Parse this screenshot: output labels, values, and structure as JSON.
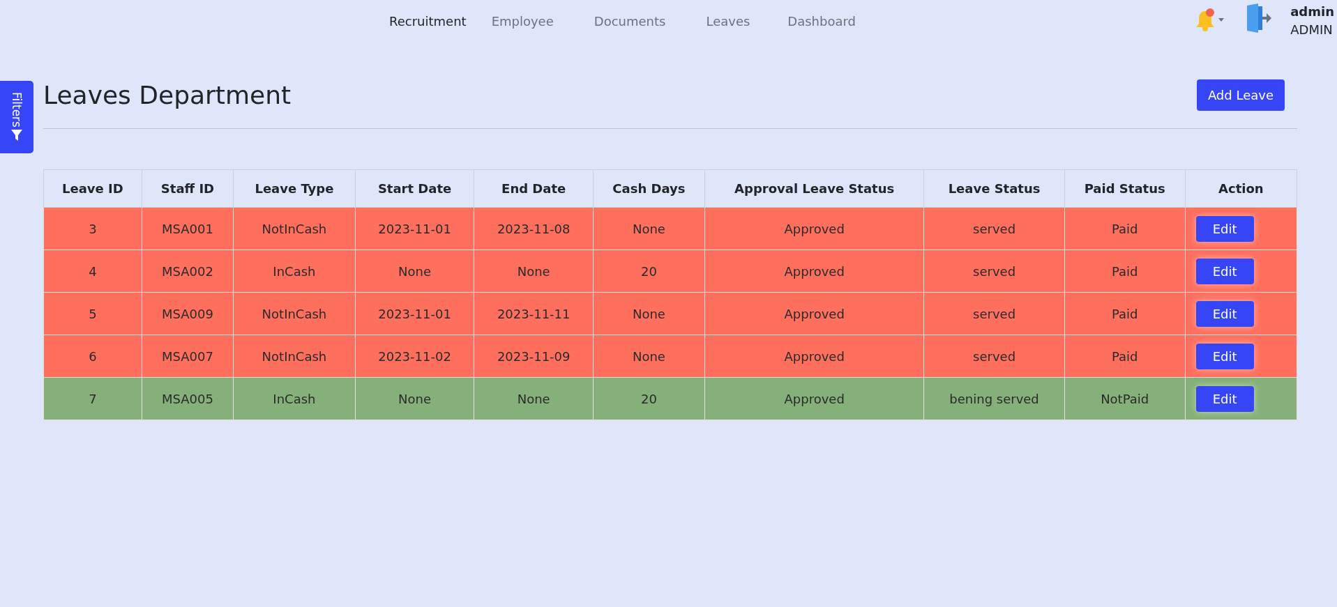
{
  "nav": [
    {
      "label": "Recruitment",
      "selected": true
    },
    {
      "label": "Employee",
      "selected": false
    },
    {
      "label": "Documents",
      "selected": false
    },
    {
      "label": "Leaves",
      "selected": false
    },
    {
      "label": "Dashboard",
      "selected": false
    }
  ],
  "notifications": {
    "unread": true
  },
  "user": {
    "name": "admin",
    "role": "ADMIN"
  },
  "filters_tab": {
    "label": "Filters"
  },
  "page": {
    "title": "Leaves Department",
    "add_button": "Add Leave"
  },
  "table": {
    "columns": [
      "Leave ID",
      "Staff ID",
      "Leave Type",
      "Start Date",
      "End Date",
      "Cash Days",
      "Approval Leave Status",
      "Leave Status",
      "Paid Status",
      "Action"
    ],
    "rows": [
      {
        "color": "#ff6f5e",
        "cells": [
          "3",
          "MSA001",
          "NotInCash",
          "2023-11-01",
          "2023-11-08",
          "None",
          "Approved",
          "served",
          "Paid"
        ],
        "action": "Edit"
      },
      {
        "color": "#ff6f5e",
        "cells": [
          "4",
          "MSA002",
          "InCash",
          "None",
          "None",
          "20",
          "Approved",
          "served",
          "Paid"
        ],
        "action": "Edit"
      },
      {
        "color": "#ff6f5e",
        "cells": [
          "5",
          "MSA009",
          "NotInCash",
          "2023-11-01",
          "2023-11-11",
          "None",
          "Approved",
          "served",
          "Paid"
        ],
        "action": "Edit"
      },
      {
        "color": "#ff6f5e",
        "cells": [
          "6",
          "MSA007",
          "NotInCash",
          "2023-11-02",
          "2023-11-09",
          "None",
          "Approved",
          "served",
          "Paid"
        ],
        "action": "Edit"
      },
      {
        "color": "#86b07a",
        "cells": [
          "7",
          "MSA005",
          "InCash",
          "None",
          "None",
          "20",
          "Approved",
          "bening served",
          "NotPaid"
        ],
        "action": "Edit"
      }
    ]
  }
}
